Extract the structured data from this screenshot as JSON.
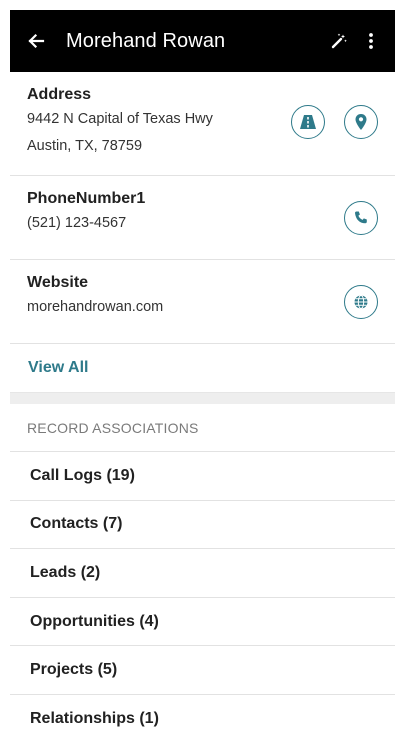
{
  "header": {
    "title": "Morehand Rowan",
    "back_icon": "arrow-left-icon",
    "edit_icon": "magic-wand-icon",
    "menu_icon": "more-vertical-icon"
  },
  "address": {
    "label": "Address",
    "line1": "9442 N Capital of Texas Hwy",
    "line2": "Austin, TX, 78759",
    "directions_icon": "directions-icon",
    "map_icon": "map-pin-icon"
  },
  "phone": {
    "label": "PhoneNumber1",
    "value": "(521) 123-4567",
    "call_icon": "phone-icon"
  },
  "website": {
    "label": "Website",
    "value": "morehandrowan.com",
    "globe_icon": "globe-icon"
  },
  "view_all": "View All",
  "associations": {
    "title": "RECORD ASSOCIATIONS",
    "items": [
      {
        "label": "Call Logs (19)"
      },
      {
        "label": "Contacts (7)"
      },
      {
        "label": "Leads (2)"
      },
      {
        "label": "Opportunities (4)"
      },
      {
        "label": "Projects (5)"
      },
      {
        "label": "Relationships (1)"
      }
    ]
  },
  "colors": {
    "accent": "#2e7a8a",
    "header_bg": "#000000",
    "divider": "#e2e2e2"
  }
}
